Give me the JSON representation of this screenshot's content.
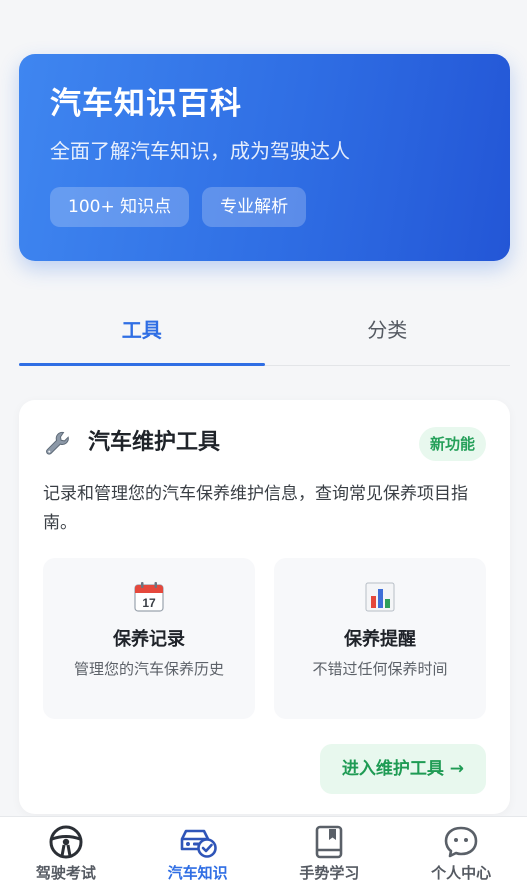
{
  "hero": {
    "title": "汽车知识百科",
    "subtitle": "全面了解汽车知识，成为驾驶达人",
    "tags": [
      "100+ 知识点",
      "专业解析"
    ]
  },
  "tabs": [
    {
      "label": "工具",
      "active": true
    },
    {
      "label": "分类",
      "active": false
    }
  ],
  "tool_card": {
    "icon": "wrench-icon",
    "title": "汽车维护工具",
    "badge": "新功能",
    "description": "记录和管理您的汽车保养维护信息，查询常见保养项目指南。",
    "features": [
      {
        "icon": "calendar-icon",
        "title": "保养记录",
        "desc": "管理您的汽车保养历史"
      },
      {
        "icon": "bar-chart-icon",
        "title": "保养提醒",
        "desc": "不错过任何保养时间"
      }
    ],
    "enter_button": "进入维护工具 →"
  },
  "bottom_nav": [
    {
      "icon": "steering-wheel-icon",
      "label": "驾驶考试",
      "active": false
    },
    {
      "icon": "car-check-icon",
      "label": "汽车知识",
      "active": true
    },
    {
      "icon": "book-icon",
      "label": "手势学习",
      "active": false
    },
    {
      "icon": "chat-face-icon",
      "label": "个人中心",
      "active": false
    }
  ],
  "colors": {
    "primary": "#2f6ee4",
    "success": "#25a05a",
    "success_bg": "#e8f8ee",
    "background": "#f5f6f8"
  }
}
